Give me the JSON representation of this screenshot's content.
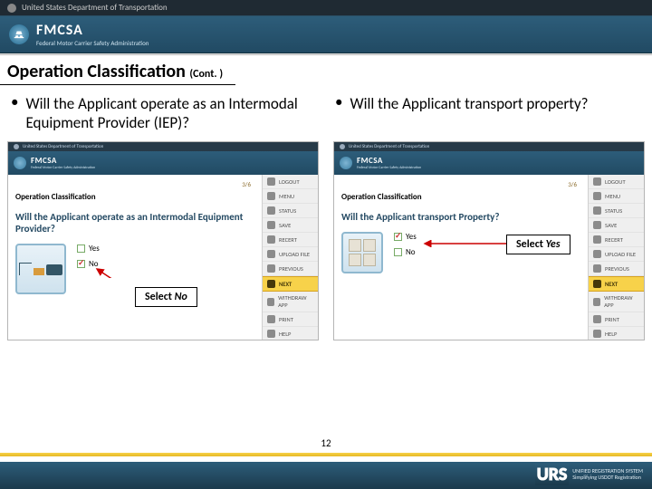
{
  "dot": {
    "label": "United States Department of Transportation"
  },
  "fmcsa": {
    "name": "FMCSA",
    "sub": "Federal Motor Carrier Safety Administration"
  },
  "slide": {
    "title": "Operation Classification",
    "cont": "(Cont. )"
  },
  "bullets": {
    "left": "Will the Applicant operate as an Intermodal Equipment Provider (IEP)?",
    "right": "Will the Applicant transport property?"
  },
  "mini": {
    "opc": "Operation Classification",
    "crumb": "3/6",
    "q_left": "Will the Applicant operate as an Intermodal Equipment Provider?",
    "q_right": "Will the Applicant transport Property?",
    "yes": "Yes",
    "no": "No",
    "side": {
      "logout": "LOGOUT",
      "menu": "MENU",
      "status": "STATUS",
      "save": "SAVE",
      "recert": "RECERT",
      "upload": "UPLOAD FILE",
      "previous": "PREVIOUS",
      "next": "NEXT",
      "withdraw": "WITHDRAW APP",
      "print": "PRINT",
      "help": "HELP"
    }
  },
  "callouts": {
    "select_no": "Select ",
    "no_i": "No",
    "select_yes": "Select ",
    "yes_i": "Yes"
  },
  "footer": {
    "page": "12",
    "urs": "URS",
    "urs_tag": "UNIFIED REGISTRATION SYSTEM",
    "urs_sub": "Simplifying USDOT Registration"
  }
}
